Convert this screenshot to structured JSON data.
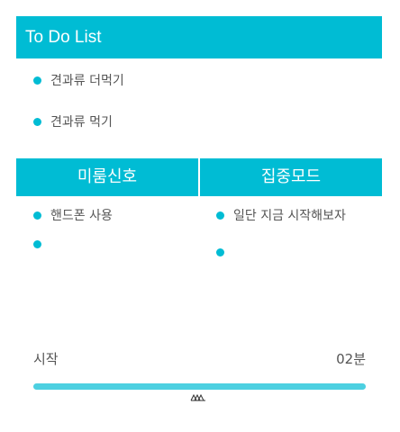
{
  "todo": {
    "title": "To Do List",
    "items": [
      "견과류 더먹기",
      "견과류 먹기"
    ]
  },
  "columns": {
    "left": {
      "title": "미룸신호",
      "items": [
        "핸드폰 사용",
        ""
      ]
    },
    "right": {
      "title": "집중모드",
      "items": [
        "일단 지금 시작해보자",
        ""
      ]
    }
  },
  "timer": {
    "start_label": "시작",
    "duration_label": "02분",
    "progress_fraction": 1.0
  },
  "icons": {
    "handle": "grip-handle-icon",
    "bullet": "bullet-dot-icon"
  },
  "colors": {
    "accent": "#00bcd4",
    "progress": "#4dd0e1",
    "text": "#555555"
  }
}
